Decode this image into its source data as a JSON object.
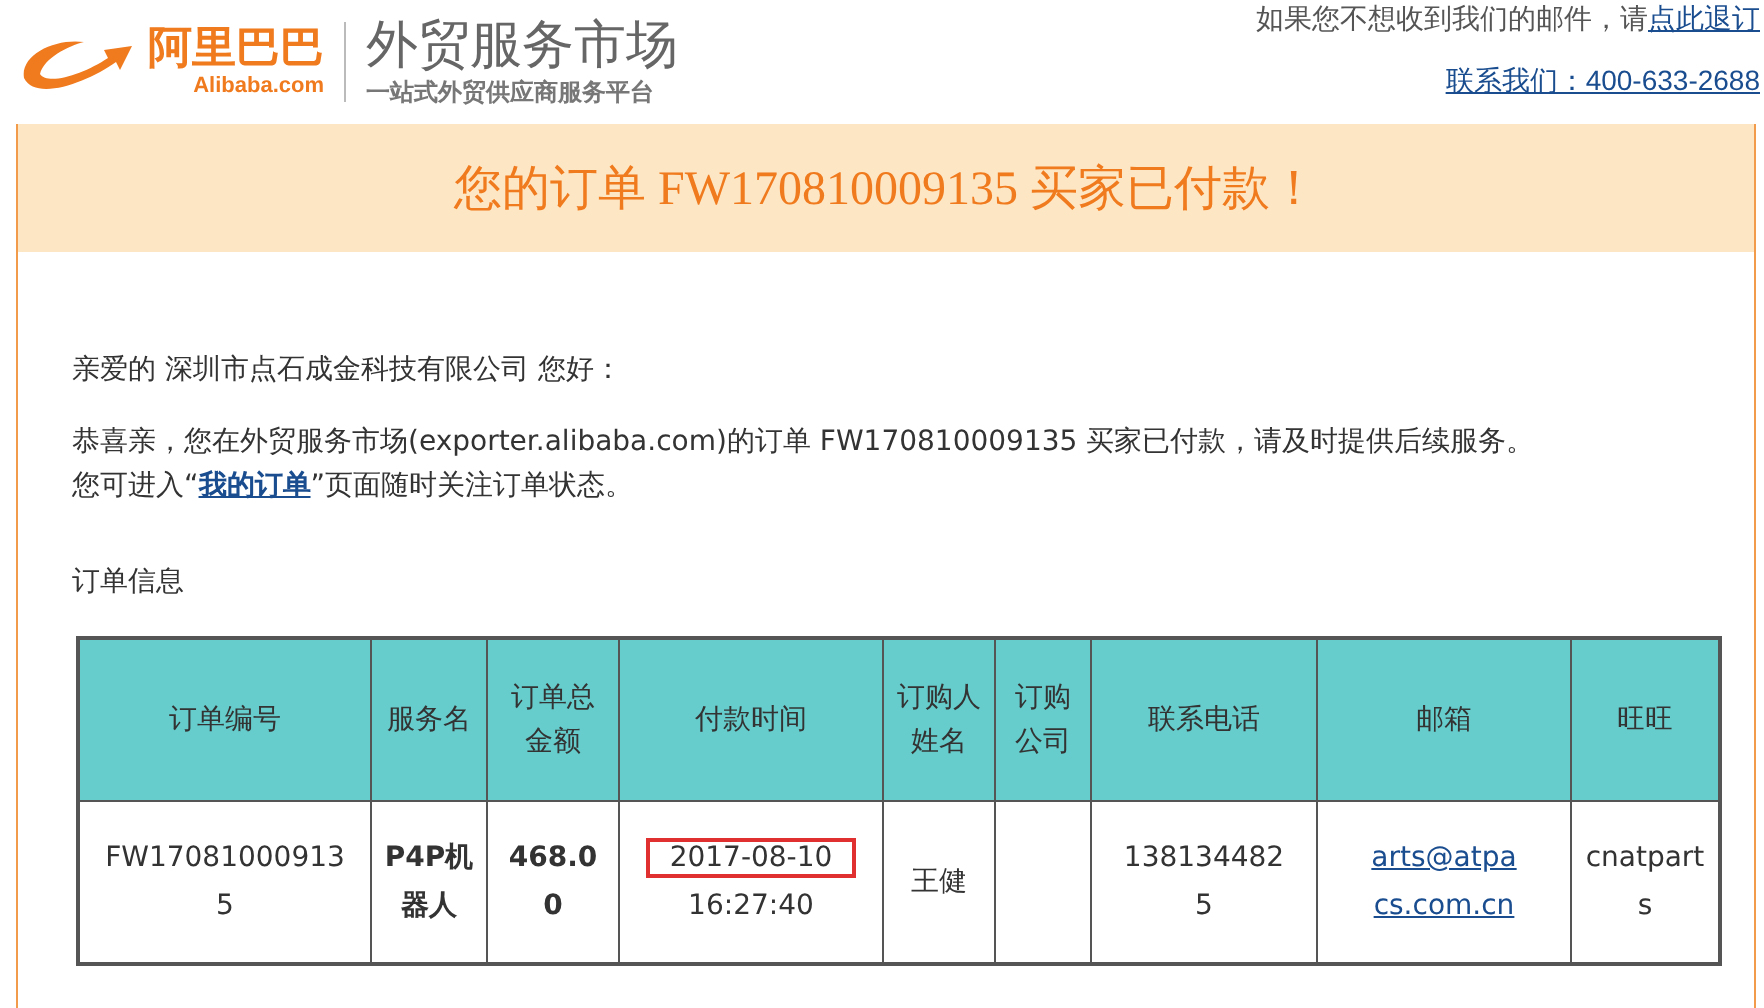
{
  "logo": {
    "brand_cn": "阿里巴巴",
    "brand_en": "Alibaba.com",
    "market": "外贸服务市场",
    "slogan": "一站式外贸供应商服务平台"
  },
  "header_links": {
    "unsubscribe_text": "如果您不想收到我们的邮件，请",
    "unsubscribe_link": "点此退订",
    "contact_link": "联系我们：400-633-2688"
  },
  "banner": {
    "title": "您的订单 FW170810009135 买家已付款！"
  },
  "greeting": "亲爱的 深圳市点石成金科技有限公司 您好：",
  "message": "恭喜亲，您在外贸服务市场(exporter.alibaba.com)的订单 FW170810009135 买家已付款，请及时提供后续服务。",
  "hint": {
    "before": "您可进入“",
    "link": "我的订单",
    "after": "”页面随时关注订单状态。"
  },
  "section_title": "订单信息",
  "table": {
    "columns": [
      {
        "lines": [
          "订单编号"
        ]
      },
      {
        "lines": [
          "服务名"
        ]
      },
      {
        "lines": [
          "订单总",
          "金额"
        ]
      },
      {
        "lines": [
          "付款时间"
        ]
      },
      {
        "lines": [
          "订购人",
          "姓名"
        ]
      },
      {
        "lines": [
          "订购",
          "公司"
        ]
      },
      {
        "lines": [
          "联系电话"
        ]
      },
      {
        "lines": [
          "邮箱"
        ]
      },
      {
        "lines": [
          "旺旺"
        ]
      }
    ],
    "rows": [
      {
        "cells": [
          {
            "kind": "text",
            "lines": [
              "FW17081000913",
              "5"
            ]
          },
          {
            "kind": "bold",
            "lines": [
              "P4P机",
              "器人"
            ]
          },
          {
            "kind": "bold",
            "lines": [
              "468.0",
              "0"
            ]
          },
          {
            "kind": "highlight",
            "lines": [
              "2017-08-10",
              "16:27:40"
            ]
          },
          {
            "kind": "text",
            "lines": [
              "王健"
            ]
          },
          {
            "kind": "empty"
          },
          {
            "kind": "text",
            "lines": [
              "138134482",
              "5"
            ]
          },
          {
            "kind": "link",
            "lines": [
              "arts@atpa",
              "cs.com.cn"
            ]
          },
          {
            "kind": "text",
            "lines": [
              "cnatpart",
              "s"
            ]
          }
        ]
      }
    ]
  }
}
